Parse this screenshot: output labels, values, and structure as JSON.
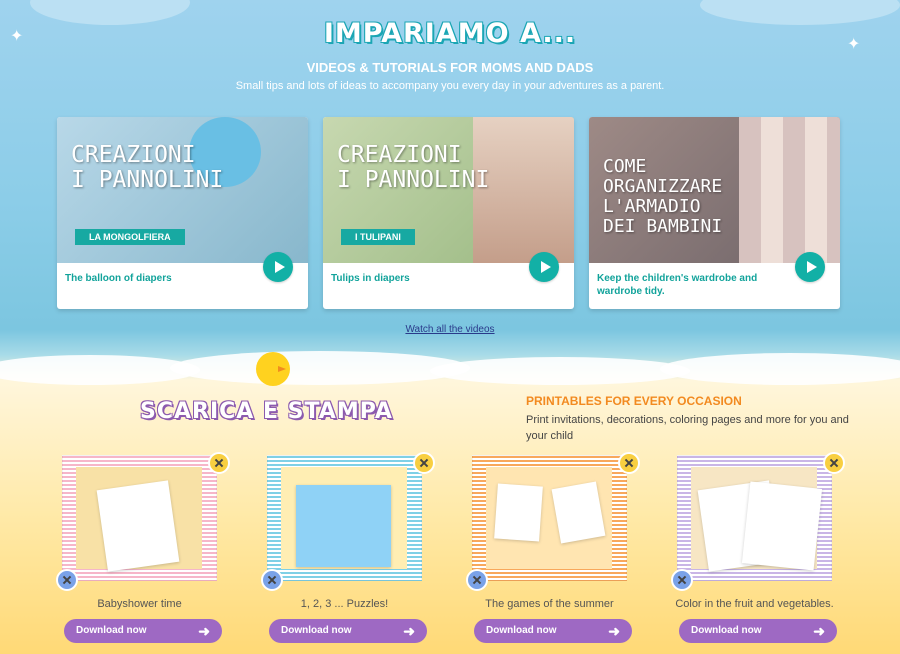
{
  "hero": {
    "logo": "IMPARIAMO A...",
    "subtitle": "VIDEOS & TUTORIALS FOR MOMS AND DADS",
    "tagline": "Small tips and lots of ideas to accompany you every day in your adventures as a parent."
  },
  "videos": [
    {
      "art": "CREAZIONI\nI PANNOLINI",
      "ribbon": "LA MONGOLFIERA",
      "label": "The balloon of diapers",
      "bg": "#9ec7d9"
    },
    {
      "art": "CREAZIONI\nI PANNOLINI",
      "ribbon": "I TULIPANI",
      "label": "Tulips in diapers",
      "bg": "#9fb88c"
    },
    {
      "art": "COME\nORGANIZZARE\nL'ARMADIO\nDEI BAMBINI",
      "ribbon": "",
      "label": "Keep the children's wardrobe and wardrobe tidy.",
      "bg": "#8a7c7a"
    }
  ],
  "watch_all": "Watch all the videos",
  "download": {
    "scarica": "SCARICA E STAMPA",
    "heading": "PRINTABLES FOR EVERY OCCASION",
    "text": "Print invitations, decorations, coloring pages and more for you and your child",
    "items": [
      {
        "caption": "Babyshower time",
        "button": "Download now",
        "frame_color": "#f6b6c9",
        "bg": "#f8e1a6"
      },
      {
        "caption": "1, 2, 3 ... Puzzles!",
        "button": "Download now",
        "frame_color": "#7fd0e6",
        "bg": "#ffeeb3"
      },
      {
        "caption": "The games of the summer",
        "button": "Download now",
        "frame_color": "#f8a85c",
        "bg": "#ffe5b1"
      },
      {
        "caption": "Color in the fruit and vegetables.",
        "button": "Download now",
        "frame_color": "#c9b5e6",
        "bg": "#f7e6c4"
      }
    ]
  },
  "colors": {
    "accent_teal": "#12b0a6",
    "download_purple": "#9e69c3",
    "orange": "#f28a20"
  }
}
